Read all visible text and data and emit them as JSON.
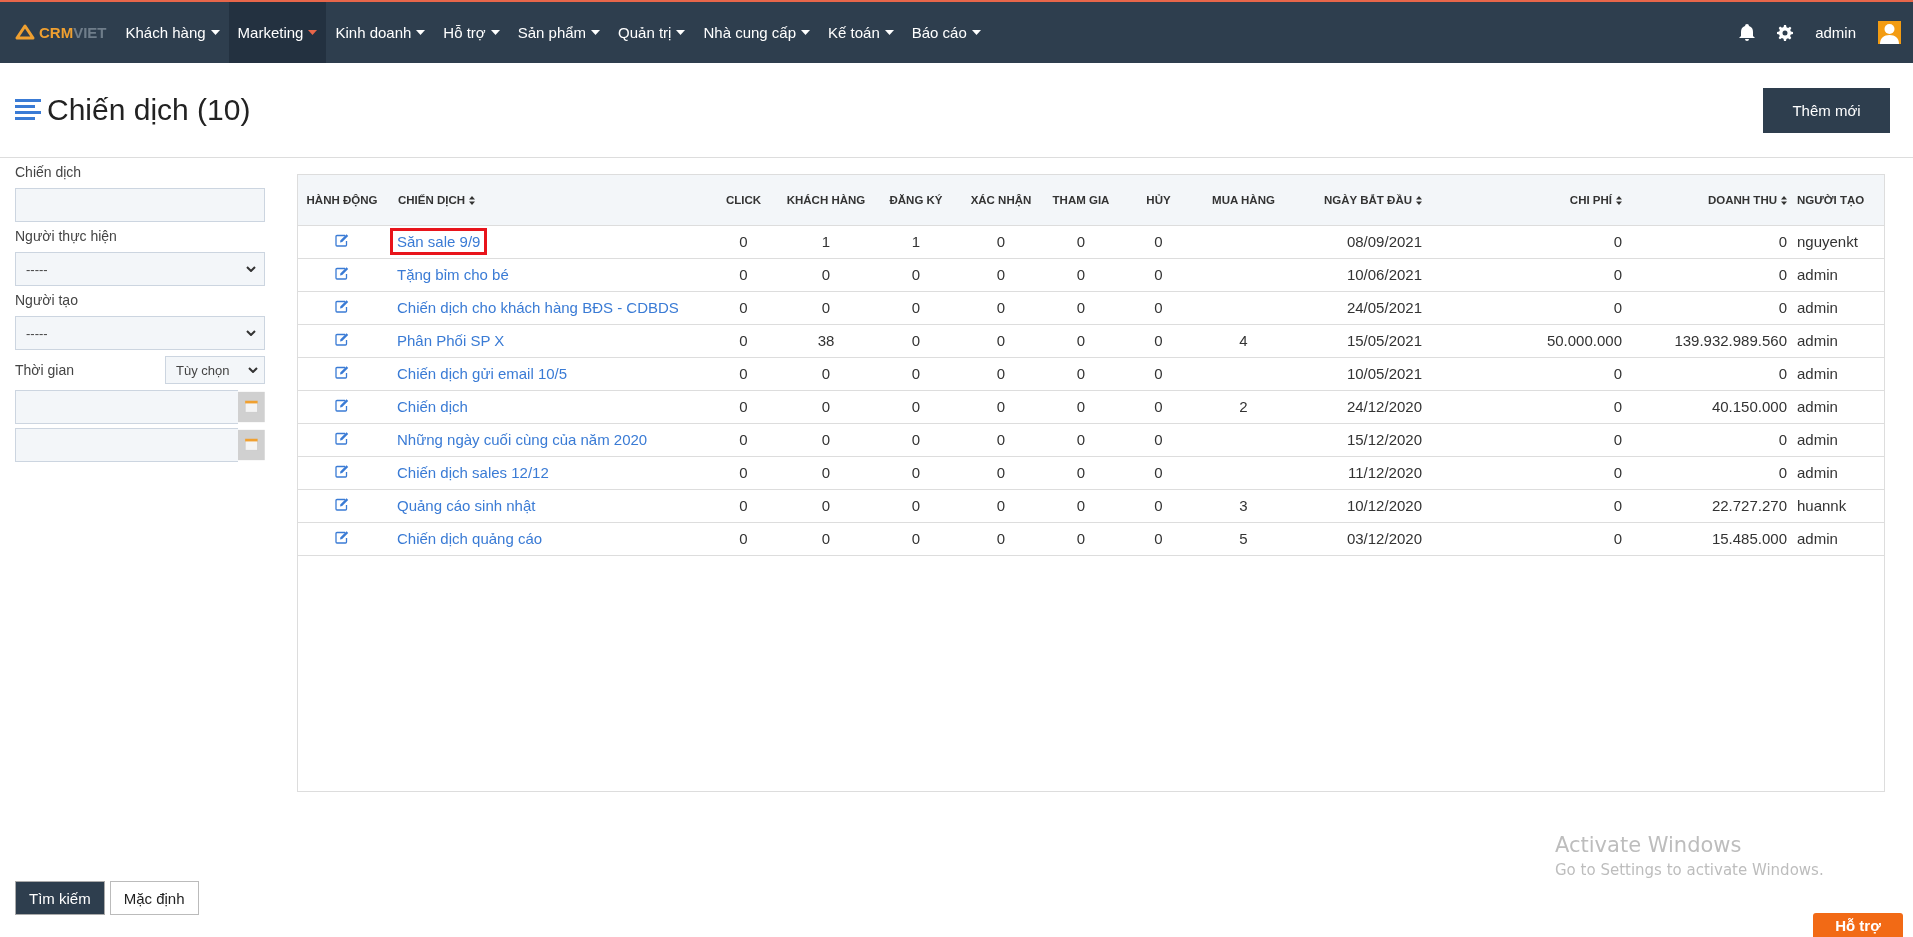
{
  "navbar": {
    "logo": {
      "part_1": "CRM",
      "part_2": "VIET"
    },
    "items": [
      {
        "label": "Khách hàng",
        "selected": false
      },
      {
        "label": "Marketing",
        "selected": true
      },
      {
        "label": "Kinh doanh",
        "selected": false
      },
      {
        "label": "Hỗ trợ",
        "selected": false
      },
      {
        "label": "Sản phẩm",
        "selected": false
      },
      {
        "label": "Quản trị",
        "selected": false
      },
      {
        "label": "Nhà cung cấp",
        "selected": false
      },
      {
        "label": "Kế toán",
        "selected": false
      },
      {
        "label": "Báo cáo",
        "selected": false
      }
    ],
    "user": "admin"
  },
  "page": {
    "title": "Chiến dịch (10)",
    "add_button": "Thêm mới"
  },
  "filters": {
    "campaign_label": "Chiến dịch",
    "performer_label": "Người thực hiện",
    "performer_value": "-----",
    "creator_label": "Người tạo",
    "creator_value": "-----",
    "time_label": "Thời gian",
    "time_value": "Tùy chọn",
    "search_button": "Tìm kiếm",
    "default_button": "Mặc định"
  },
  "table": {
    "action_column": "HÀNH ĐỘNG",
    "columns": [
      {
        "label": "CHIẾN DỊCH",
        "sortable": true
      },
      {
        "label": "CLICK",
        "sortable": false
      },
      {
        "label": "KHÁCH HÀNG",
        "sortable": false
      },
      {
        "label": "ĐĂNG KÝ",
        "sortable": false
      },
      {
        "label": "XÁC NHẬN",
        "sortable": false
      },
      {
        "label": "THAM GIA",
        "sortable": false
      },
      {
        "label": "HỦY",
        "sortable": false
      },
      {
        "label": "MUA HÀNG",
        "sortable": false
      },
      {
        "label": "NGÀY BẮT ĐẦU",
        "sortable": true
      },
      {
        "label": "CHI PHÍ",
        "sortable": true
      },
      {
        "label": "DOANH THU",
        "sortable": true
      },
      {
        "label": "NGƯỜI TẠO",
        "sortable": false
      }
    ],
    "rows": [
      {
        "highlighted": true,
        "cells": [
          "Săn sale 9/9",
          "0",
          "1",
          "1",
          "0",
          "0",
          "0",
          "",
          "08/09/2021",
          "0",
          "0",
          "nguyenkt"
        ]
      },
      {
        "highlighted": false,
        "cells": [
          "Tặng bỉm cho bé",
          "0",
          "0",
          "0",
          "0",
          "0",
          "0",
          "",
          "10/06/2021",
          "0",
          "0",
          "admin"
        ]
      },
      {
        "highlighted": false,
        "cells": [
          "Chiến dịch cho khách hàng BĐS - CDBDS",
          "0",
          "0",
          "0",
          "0",
          "0",
          "0",
          "",
          "24/05/2021",
          "0",
          "0",
          "admin"
        ]
      },
      {
        "highlighted": false,
        "cells": [
          "Phân Phối SP X",
          "0",
          "38",
          "0",
          "0",
          "0",
          "0",
          "4",
          "15/05/2021",
          "50.000.000",
          "139.932.989.560",
          "admin"
        ]
      },
      {
        "highlighted": false,
        "cells": [
          "Chiến dịch gửi email 10/5",
          "0",
          "0",
          "0",
          "0",
          "0",
          "0",
          "",
          "10/05/2021",
          "0",
          "0",
          "admin"
        ]
      },
      {
        "highlighted": false,
        "cells": [
          "Chiến dịch",
          "0",
          "0",
          "0",
          "0",
          "0",
          "0",
          "2",
          "24/12/2020",
          "0",
          "40.150.000",
          "admin"
        ]
      },
      {
        "highlighted": false,
        "cells": [
          "Những ngày cuối cùng của năm 2020",
          "0",
          "0",
          "0",
          "0",
          "0",
          "0",
          "",
          "15/12/2020",
          "0",
          "0",
          "admin"
        ]
      },
      {
        "highlighted": false,
        "cells": [
          "Chiến dịch sales 12/12",
          "0",
          "0",
          "0",
          "0",
          "0",
          "0",
          "",
          "11/12/2020",
          "0",
          "0",
          "admin"
        ]
      },
      {
        "highlighted": false,
        "cells": [
          "Quảng cáo sinh nhật",
          "0",
          "0",
          "0",
          "0",
          "0",
          "0",
          "3",
          "10/12/2020",
          "0",
          "22.727.270",
          "huannk"
        ]
      },
      {
        "highlighted": false,
        "cells": [
          "Chiến dịch quảng cáo",
          "0",
          "0",
          "0",
          "0",
          "0",
          "0",
          "5",
          "03/12/2020",
          "0",
          "15.485.000",
          "admin"
        ]
      }
    ]
  },
  "os_notice": {
    "title": "Activate Windows",
    "text": "Go to Settings to activate Windows."
  },
  "help_button": "Hỗ trợ"
}
